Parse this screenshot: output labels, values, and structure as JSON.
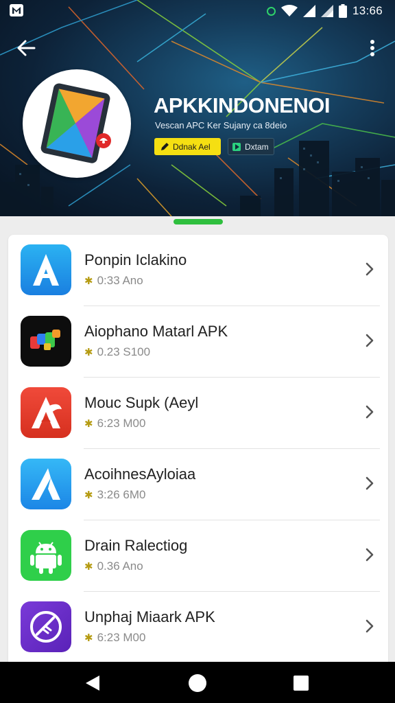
{
  "status_bar": {
    "time": "13:66",
    "icons": [
      "app-notification-icon",
      "sync-ring-icon",
      "wifi-icon",
      "signal-icon",
      "signal-icon",
      "battery-icon"
    ]
  },
  "toolbar": {
    "back_icon": "arrow-left-icon",
    "menu_icon": "more-vert-icon"
  },
  "app_header": {
    "title": "APKKINDONENOI",
    "subtitle": "Vescan APC Ker Sujany ca 8deio",
    "chip_primary": "Ddnak Ael",
    "chip_secondary": "Dxtam",
    "accent_color": "#f5df12"
  },
  "apps": [
    {
      "title": "Ponpin Iclakino",
      "meta": "0:33 Ano",
      "icon": "letter-a-blue-icon"
    },
    {
      "title": "Aiophano Matarl APK",
      "meta": "0.23 S100",
      "icon": "colorful-blocks-icon"
    },
    {
      "title": "Mouc Supk (Aeyl",
      "meta": "6:23 M00",
      "icon": "letter-a-red-icon"
    },
    {
      "title": "AcoihnesAyloiaa",
      "meta": "3:26 6M0",
      "icon": "letter-a-blue-light-icon"
    },
    {
      "title": "Drain Ralectiog",
      "meta": "0.36 Ano",
      "icon": "android-icon"
    },
    {
      "title": "Unphaj Miaark APK",
      "meta": "6:23 M00",
      "icon": "compass-purple-icon"
    }
  ],
  "nav": {
    "back": "nav-back-icon",
    "home": "nav-home-icon",
    "recents": "nav-recents-icon"
  },
  "colors": {
    "header_dark": "#0d2238",
    "handle_green": "#2fbf3e",
    "star": "#b59b12"
  }
}
